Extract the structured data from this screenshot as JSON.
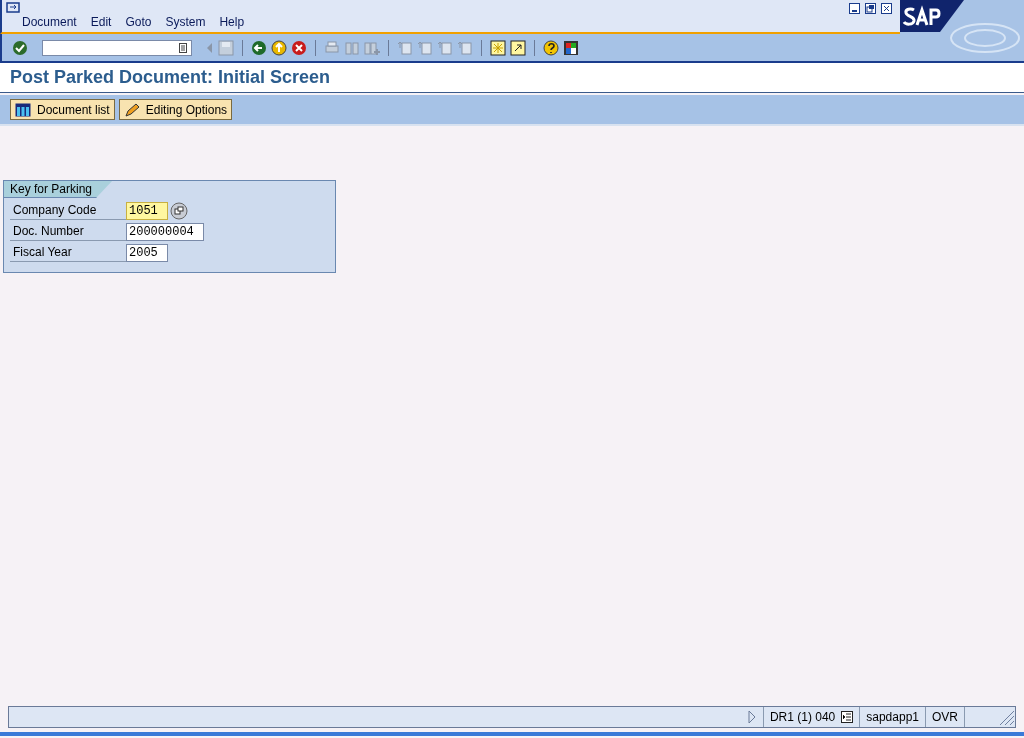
{
  "menu": [
    {
      "label": "Document"
    },
    {
      "label": "Edit"
    },
    {
      "label": "Goto"
    },
    {
      "label": "System"
    },
    {
      "label": "Help"
    }
  ],
  "title": "Post Parked Document: Initial Screen",
  "app_toolbar": [
    {
      "label": "Document list",
      "kind": "list"
    },
    {
      "label": "Editing Options",
      "kind": "pencil"
    }
  ],
  "group": {
    "title": "Key for Parking",
    "fields": [
      {
        "label": "Company Code",
        "value": "1051",
        "focused": true,
        "lookup": true
      },
      {
        "label": "Doc. Number",
        "value": "200000004",
        "focused": false,
        "lookup": false
      },
      {
        "label": "Fiscal Year",
        "value": "2005",
        "focused": false,
        "lookup": false
      }
    ]
  },
  "status_bar": {
    "system": "DR1 (1) 040",
    "server": "sapdapp1",
    "mode": "OVR"
  }
}
